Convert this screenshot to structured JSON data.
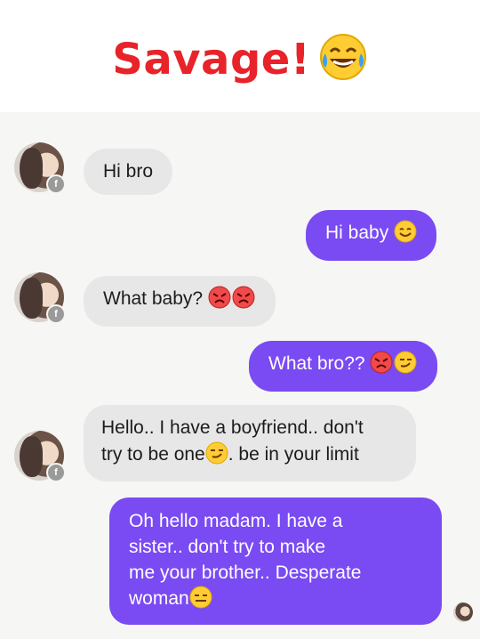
{
  "header": {
    "title": "Savage!",
    "emoji": "laughing-crying-emoji"
  },
  "avatar_badge": "f",
  "messages": [
    {
      "side": "in",
      "text": "Hi bro"
    },
    {
      "side": "out",
      "text": "Hi baby"
    },
    {
      "side": "in",
      "text": "What baby?"
    },
    {
      "side": "out",
      "text": "What bro??"
    },
    {
      "side": "in",
      "line1": "Hello.. I have a boyfriend.. don't",
      "line2a": "try to be one",
      "line2b": ".  be in your limit"
    },
    {
      "side": "out",
      "line1": "Oh hello madam.  I have a",
      "line2": "sister..  don't try to make",
      "line3": "me your brother.. Desperate",
      "line4": "woman"
    }
  ],
  "colors": {
    "title": "#e8232a",
    "outgoing_bubble": "#7a4af3",
    "incoming_bubble": "#e7e7e7",
    "chat_bg": "#f6f6f4"
  }
}
